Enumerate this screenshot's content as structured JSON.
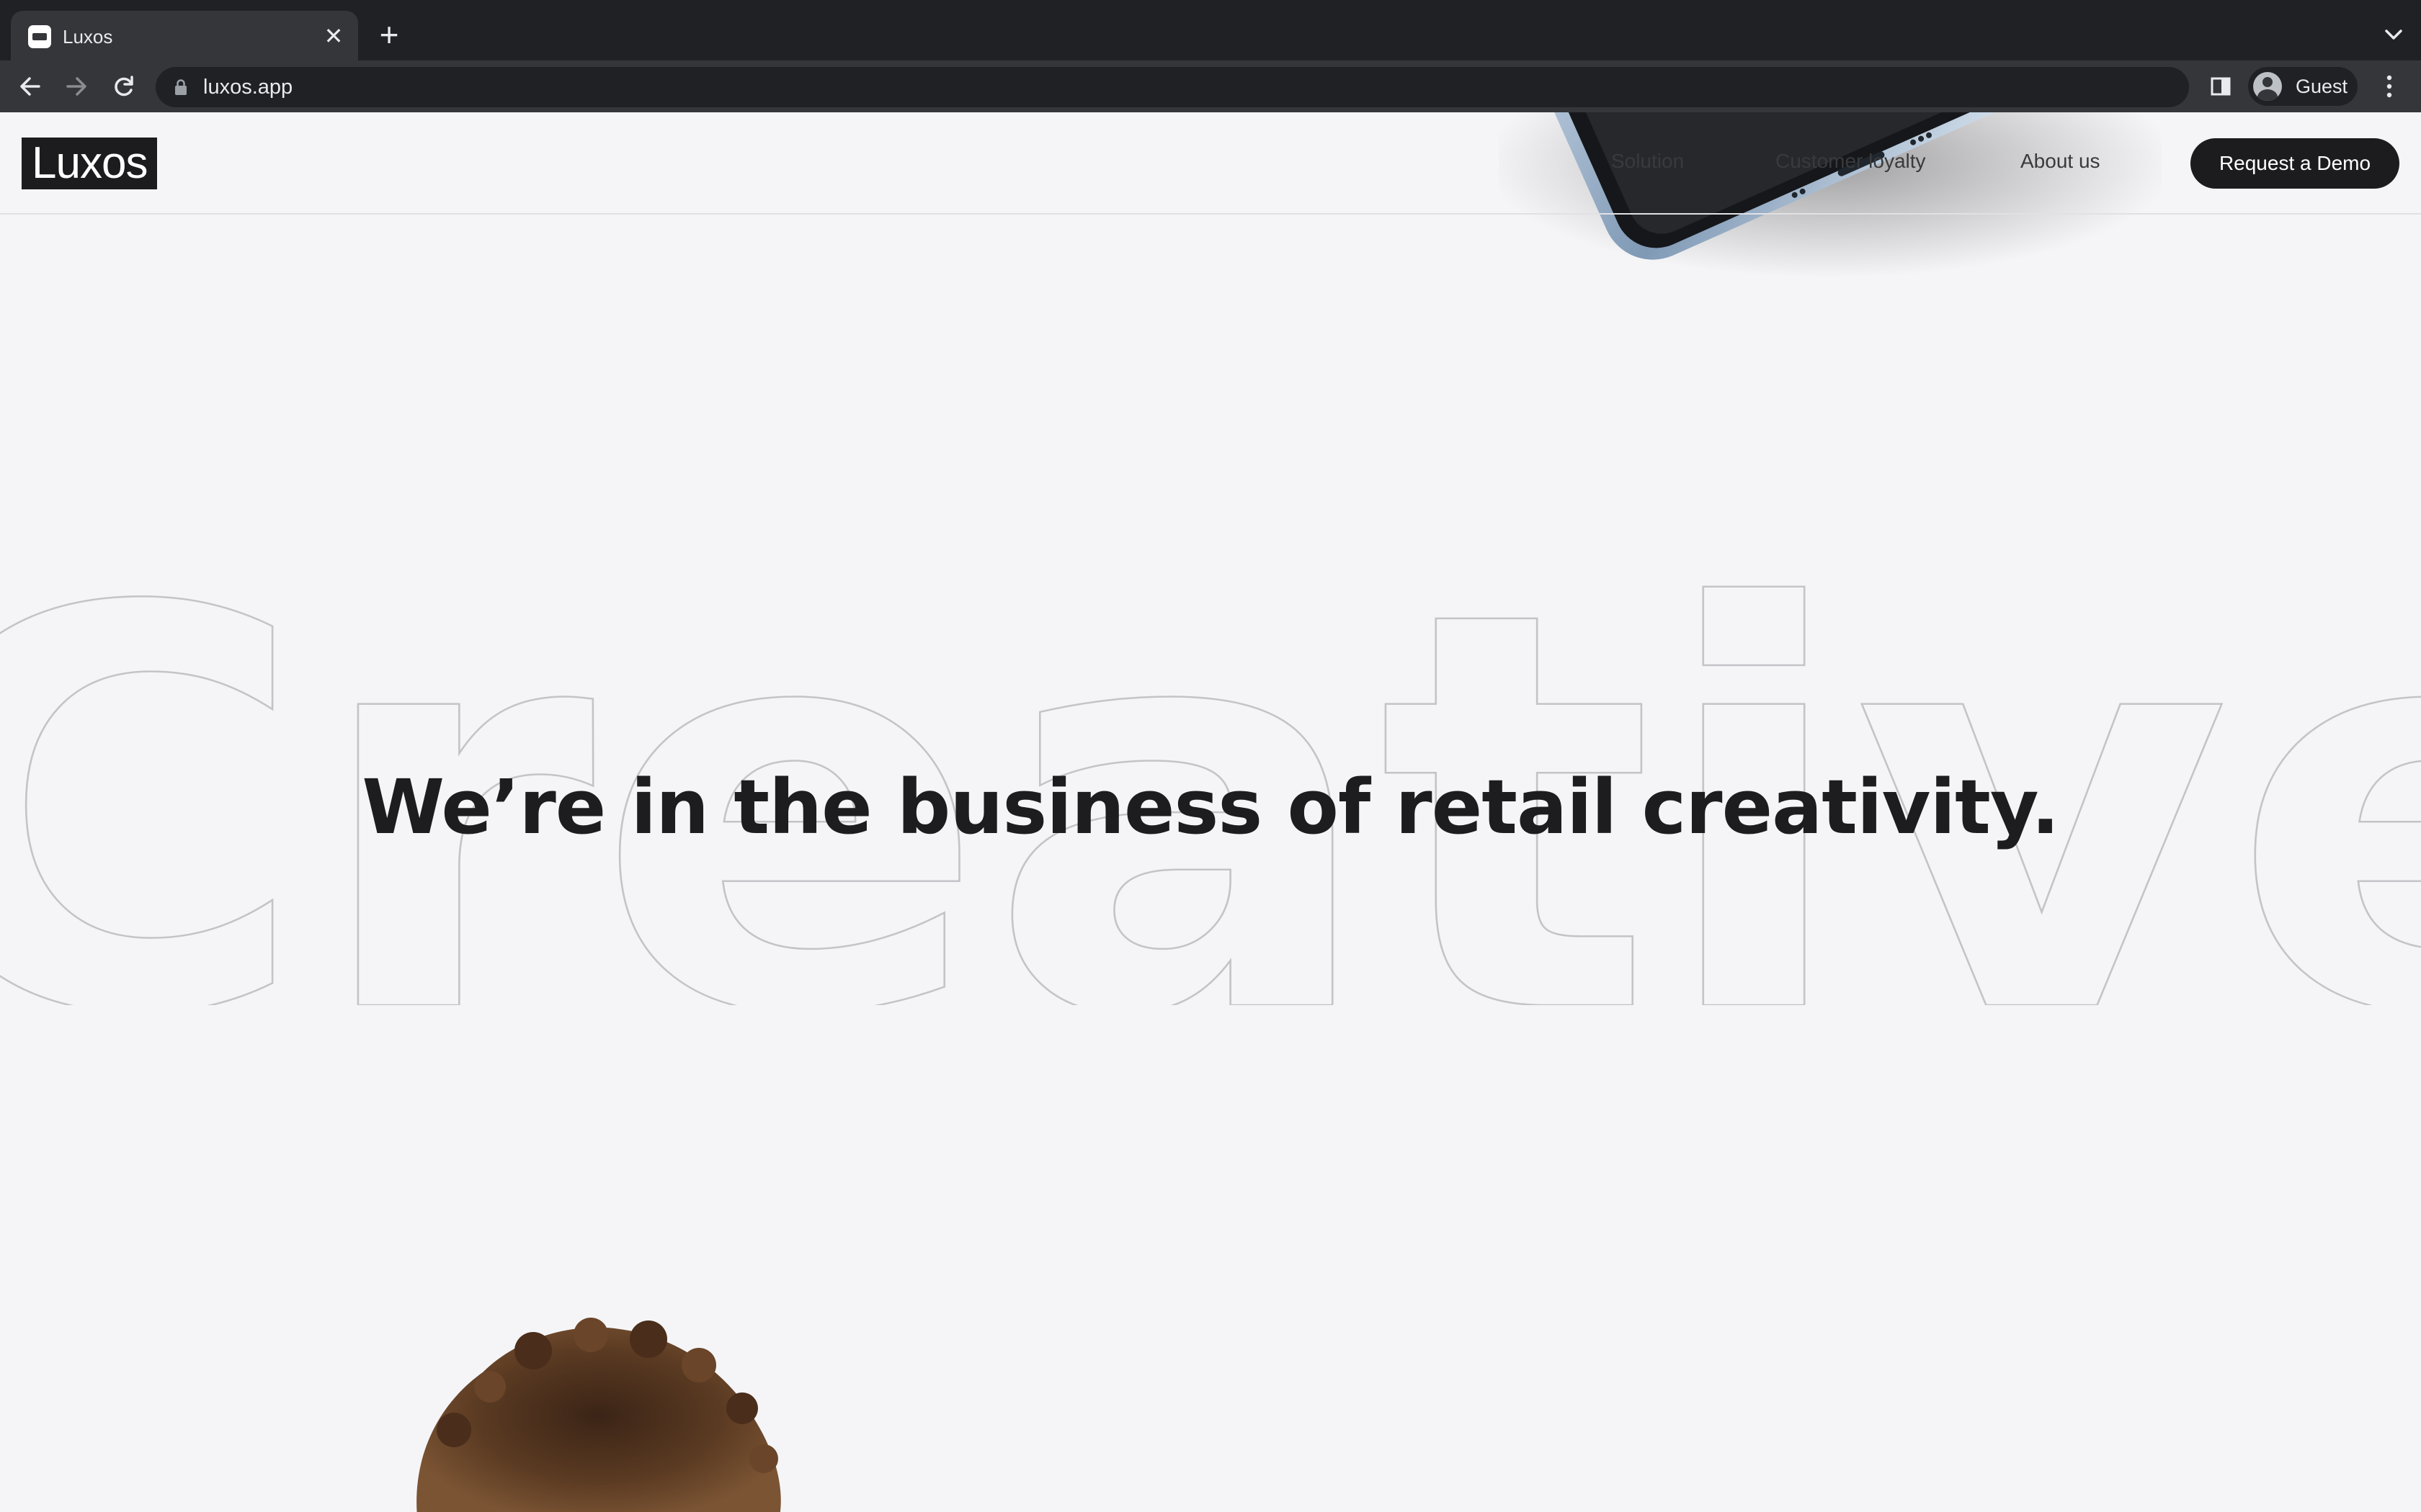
{
  "browser": {
    "tab": {
      "title": "Luxos",
      "close_glyph": "✕",
      "favicon": "browser-window-icon"
    },
    "new_tab_glyph": "+",
    "url": "luxos.app",
    "profile": {
      "name": "Guest"
    },
    "icons": [
      "back-arrow-icon",
      "forward-arrow-icon",
      "reload-icon",
      "lock-icon",
      "side-panel-icon",
      "avatar-icon",
      "kebab-menu-icon",
      "tab-search-icon"
    ]
  },
  "site": {
    "logo": "Luxos",
    "nav": [
      {
        "label": "Solution"
      },
      {
        "label": "Customer loyalty"
      },
      {
        "label": "About us"
      }
    ],
    "cta_label": "Request a Demo"
  },
  "hero": {
    "background_word": "Creative",
    "headline": "We’re in the business of retail creativity."
  },
  "colors": {
    "chrome_dark": "#202124",
    "chrome_toolbar": "#35363a",
    "page_bg": "#f5f5f7",
    "ink": "#1d1d1f",
    "button_bg": "#1c1c1e",
    "outline": "#c4c4c8"
  }
}
